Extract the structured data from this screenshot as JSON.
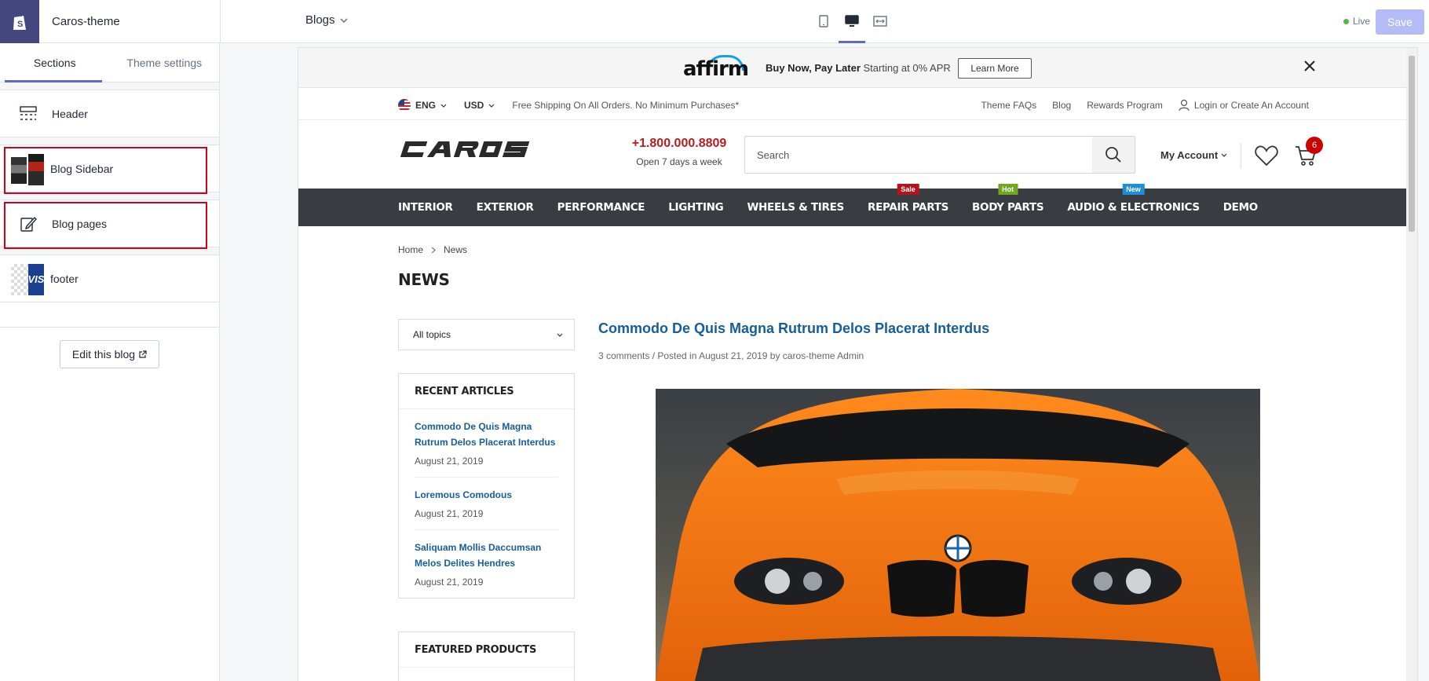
{
  "editor": {
    "theme_name": "Caros-theme",
    "page_select": "Blogs",
    "live_label": "Live",
    "save_label": "Save"
  },
  "sidebar": {
    "tabs": [
      "Sections",
      "Theme settings"
    ],
    "sections": [
      {
        "label": "Header",
        "icon": "header-layout-icon"
      },
      {
        "label": "Blog Sidebar",
        "icon": "blog-sidebar-thumbnail"
      },
      {
        "label": "Blog pages",
        "icon": "edit-page-icon"
      },
      {
        "label": "footer",
        "icon": "footer-thumbnail"
      }
    ],
    "edit_blog_label": "Edit this blog"
  },
  "store": {
    "affirm": {
      "logo": "affirm",
      "text_bold": "Buy Now, Pay Later",
      "text_rest": " Starting at 0% APR",
      "button": "Learn More"
    },
    "utility": {
      "language": "ENG",
      "currency": "USD",
      "shipping": "Free Shipping On All Orders. No Minimum Purchases*",
      "links": [
        "Theme FAQs",
        "Blog",
        "Rewards Program"
      ],
      "account": "Login or Create An Account"
    },
    "header": {
      "phone": "+1.800.000.8809",
      "phone_sub": "Open 7 days a week",
      "search_placeholder": "Search",
      "my_account": "My Account",
      "cart_count": "6"
    },
    "nav": [
      {
        "label": "INTERIOR",
        "badge": null
      },
      {
        "label": "EXTERIOR",
        "badge": null
      },
      {
        "label": "PERFORMANCE",
        "badge": null
      },
      {
        "label": "LIGHTING",
        "badge": null
      },
      {
        "label": "WHEELS & TIRES",
        "badge": null
      },
      {
        "label": "REPAIR PARTS",
        "badge": "Sale",
        "badge_color": "#b5121b"
      },
      {
        "label": "BODY PARTS",
        "badge": "Hot",
        "badge_color": "#6fa81e"
      },
      {
        "label": "AUDIO & ELECTRONICS",
        "badge": "New",
        "badge_color": "#1b8fd9"
      },
      {
        "label": "DEMO",
        "badge": null
      }
    ],
    "breadcrumb": [
      "Home",
      "News"
    ],
    "page_title": "NEWS",
    "topics_select": "All topics",
    "recent_title": "RECENT ARTICLES",
    "recent_articles": [
      {
        "title": "Commodo De Quis Magna Rutrum Delos Placerat Interdus",
        "date": "August 21, 2019"
      },
      {
        "title": "Loremous Comodous",
        "date": "August 21, 2019"
      },
      {
        "title": "Saliquam Mollis Daccumsan Melos Delites Hendres",
        "date": "August 21, 2019"
      }
    ],
    "featured_title": "FEATURED PRODUCTS",
    "post": {
      "title": "Commodo De Quis Magna Rutrum Delos Placerat Interdus",
      "meta": "3 comments / Posted in August 21, 2019 by caros-theme Admin"
    }
  },
  "colors": {
    "accent": "#5c6ac4",
    "nav_bg": "#393d42",
    "link_blue": "#155e9a",
    "phone_red": "#b51e23",
    "highlight_red": "#d0021b"
  }
}
